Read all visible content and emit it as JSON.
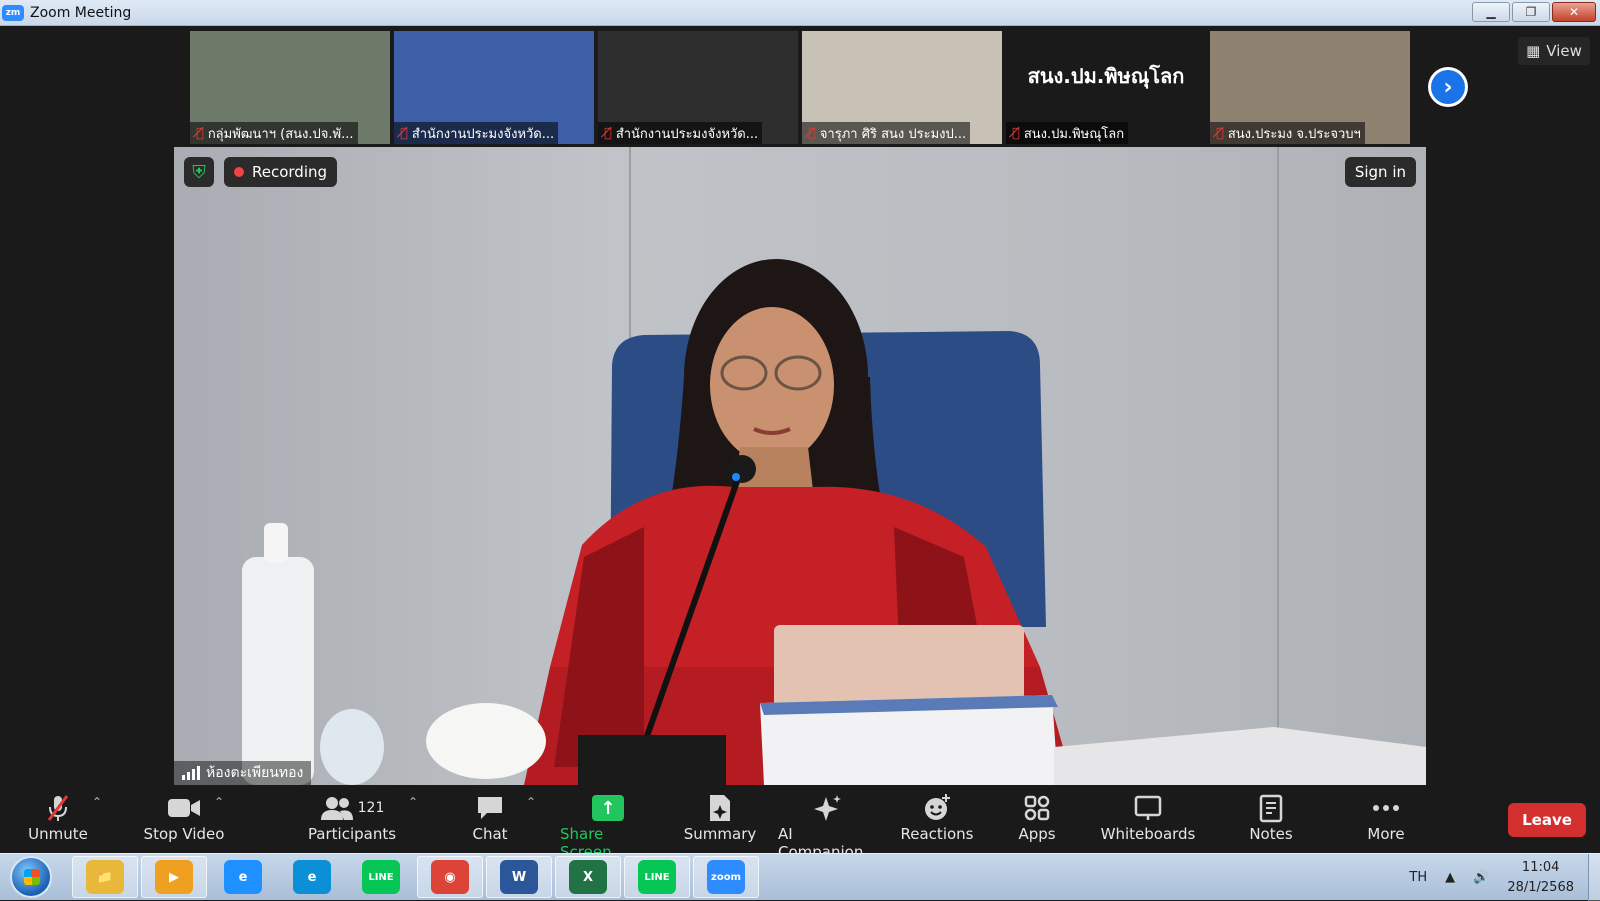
{
  "window": {
    "title": "Zoom Meeting",
    "app_logo": "zm",
    "controls": {
      "minimize": "▁",
      "restore": "❐",
      "close": "✕"
    }
  },
  "gallery": {
    "tiles": [
      {
        "name": "กลุ่มพัฒนาฯ (สนง.ปจ.พั...",
        "muted": true,
        "bg": "#6d7a6a"
      },
      {
        "name": "สำนักงานประมงจังหวัด...",
        "muted": true,
        "bg": "#3c5fa8"
      },
      {
        "name": "สำนักงานประมงจังหวัด...",
        "muted": true,
        "bg": "#2e2e2e"
      },
      {
        "name": "จารุภา ศิริ สนง ประมงป...",
        "muted": true,
        "bg": "#c7c1b6"
      },
      {
        "name": "สนง.ปม.พิษณุโลก",
        "muted": true,
        "bg": "#1a1a1a",
        "display_text": "สนง.ปม.พิษณุโลก"
      },
      {
        "name": "สนง.ประมง จ.ประจวบฯ",
        "muted": true,
        "bg": "#8f8170"
      }
    ],
    "next_arrow": "›",
    "view_label": "View"
  },
  "main_video": {
    "recording_label": "Recording",
    "sign_in_label": "Sign in",
    "speaker_name": "ห้องตะเพียนทอง"
  },
  "toolbar": {
    "unmute": "Unmute",
    "stop_video": "Stop Video",
    "participants": "Participants",
    "participants_count": "121",
    "chat": "Chat",
    "share_screen": "Share Screen",
    "summary": "Summary",
    "ai_companion": "AI Companion",
    "reactions": "Reactions",
    "apps": "Apps",
    "whiteboards": "Whiteboards",
    "notes": "Notes",
    "more": "More",
    "leave": "Leave"
  },
  "taskbar": {
    "apps": [
      {
        "name": "file-explorer",
        "color": "#e8b83a",
        "glyph": "📁",
        "pinned": true
      },
      {
        "name": "media-player",
        "color": "#f0a020",
        "glyph": "▶",
        "pinned": true
      },
      {
        "name": "internet-explorer",
        "color": "#1e90ff",
        "glyph": "e",
        "pinned": false
      },
      {
        "name": "edge",
        "color": "#0b8fd6",
        "glyph": "e",
        "pinned": false
      },
      {
        "name": "line",
        "color": "#06c755",
        "glyph": "LINE",
        "pinned": false
      },
      {
        "name": "chrome",
        "color": "#db4437",
        "glyph": "◉",
        "pinned": true
      },
      {
        "name": "word",
        "color": "#2b579a",
        "glyph": "W",
        "pinned": true
      },
      {
        "name": "excel",
        "color": "#217346",
        "glyph": "X",
        "pinned": true
      },
      {
        "name": "line",
        "color": "#06c755",
        "glyph": "LINE",
        "pinned": true
      },
      {
        "name": "zoom",
        "color": "#2d8cff",
        "glyph": "zoom",
        "pinned": true
      }
    ],
    "language": "TH",
    "time": "11:04",
    "date": "28/1/2568"
  },
  "colors": {
    "accent": "#2d8cff",
    "recording": "#ef4444",
    "share_green": "#22c55e",
    "leave_red": "#d32f2f",
    "muted_red": "#e53935"
  }
}
